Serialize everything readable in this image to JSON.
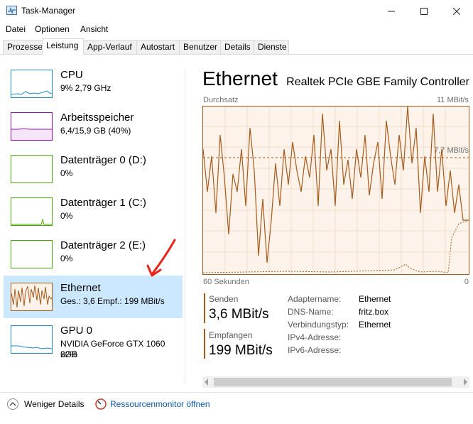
{
  "window": {
    "title": "Task-Manager"
  },
  "menu": [
    "Datei",
    "Optionen",
    "Ansicht"
  ],
  "tabs": [
    "Prozesse",
    "Leistung",
    "App-Verlauf",
    "Autostart",
    "Benutzer",
    "Details",
    "Dienste"
  ],
  "active_tab": "Leistung",
  "resources": [
    {
      "name": "CPU",
      "line1": "9% 2,79 GHz",
      "line2": "",
      "color": "#1b8ac9"
    },
    {
      "name": "Arbeitsspeicher",
      "line1": "6,4/15,9 GB (40%)",
      "line2": "",
      "color": "#8b12ae"
    },
    {
      "name": "Datenträger 0 (D:)",
      "line1": "0%",
      "line2": "",
      "color": "#4da60c"
    },
    {
      "name": "Datenträger 1 (C:)",
      "line1": "0%",
      "line2": "",
      "color": "#4da60c"
    },
    {
      "name": "Datenträger 2 (E:)",
      "line1": "0%",
      "line2": "",
      "color": "#4da60c"
    },
    {
      "name": "Ethernet",
      "line1": "Ges.: 3,6 Empf.: 199 MBit/s",
      "line2": "",
      "color": "#a55a1a"
    },
    {
      "name": "GPU 0",
      "line1": "NVIDIA GeForce GTX 1060 6GB",
      "line2": "22%",
      "color": "#1b8ac9"
    }
  ],
  "selected_resource": "Ethernet",
  "detail": {
    "title": "Ethernet",
    "adapter": "Realtek PCIe GBE Family Controller",
    "graph_top_left": "Durchsatz",
    "graph_top_right": "11 MBit/s",
    "graph_mid_right": "7,7 MBit/s",
    "graph_bottom_left": "60 Sekunden",
    "graph_bottom_right": "0"
  },
  "stats": {
    "send_label": "Senden",
    "send_value": "3,6 MBit/s",
    "recv_label": "Empfangen",
    "recv_value": "199 MBit/s"
  },
  "properties": [
    {
      "key": "Adaptername:",
      "value": "Ethernet"
    },
    {
      "key": "DNS-Name:",
      "value": "fritz.box"
    },
    {
      "key": "Verbindungstyp:",
      "value": "Ethernet"
    },
    {
      "key": "IPv4-Adresse:",
      "value": ""
    },
    {
      "key": "IPv6-Adresse:",
      "value": ""
    }
  ],
  "footer": {
    "fewer_details": "Weniger Details",
    "resource_monitor": "Ressourcenmonitor öffnen"
  },
  "colors": {
    "ethernet": "#a55a1a",
    "selection": "#cce8ff",
    "annotation": "#e8231a"
  }
}
